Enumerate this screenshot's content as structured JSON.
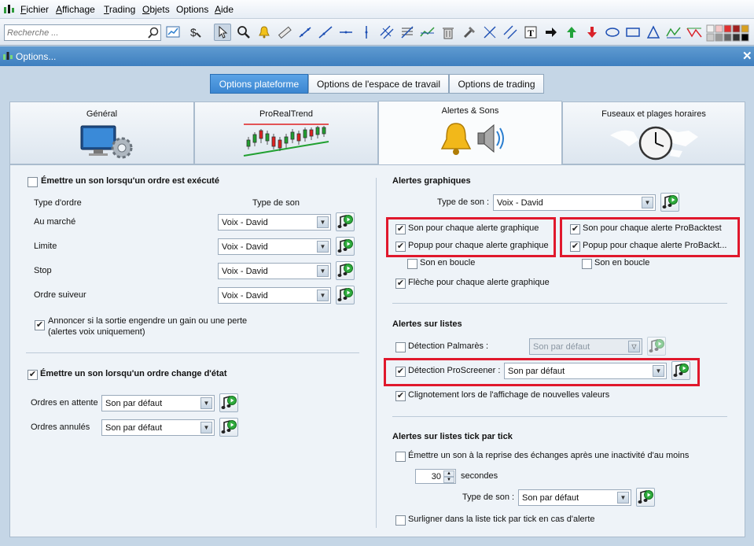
{
  "menubar": {
    "items": [
      {
        "label": "Fichier",
        "key": "F",
        "rest": "ichier"
      },
      {
        "label": "Affichage",
        "key": "A",
        "rest": "ffichage"
      },
      {
        "label": "Trading",
        "key": "T",
        "rest": "rading"
      },
      {
        "label": "Objets",
        "key": "O",
        "rest": "bjets"
      },
      {
        "label": "Options",
        "key": "",
        "rest": "Options"
      },
      {
        "label": "Aide",
        "key": "A",
        "rest": "ide"
      }
    ]
  },
  "toolbar": {
    "search_placeholder": "Recherche ...",
    "icons": [
      "chart-window-icon",
      "dollar-tool-icon",
      "pointer-icon",
      "zoom-icon",
      "alert-bell-icon",
      "ruler-icon",
      "line-icon",
      "line-icon",
      "horizontal-line-icon",
      "vertical-line-icon",
      "channel-icon",
      "fibonacci-icon",
      "trend-icon",
      "trash-icon",
      "tools-icon",
      "arrow-line-icon",
      "parallel-icon",
      "text-icon",
      "arrow-right-icon",
      "arrow-up-icon",
      "arrow-down-icon",
      "ellipse-icon",
      "rectangle-icon",
      "triangle-icon",
      "zigzag-icon",
      "pattern-icon",
      "color-palette-icon"
    ]
  },
  "window": {
    "title": "Options...",
    "close": "✕"
  },
  "segments": [
    {
      "label": "Options plateforme",
      "selected": true
    },
    {
      "label": "Options de l'espace de travail",
      "selected": false
    },
    {
      "label": "Options de trading",
      "selected": false
    }
  ],
  "tabs": [
    {
      "label": "Général",
      "icon": "monitor-gear-icon",
      "selected": false
    },
    {
      "label": "ProRealTrend",
      "icon": "candlestick-chart-icon",
      "selected": false
    },
    {
      "label": "Alertes & Sons",
      "icon": "bell-speaker-icon",
      "selected": true
    },
    {
      "label": "Fuseaux et plages horaires",
      "icon": "world-clock-icon",
      "selected": false
    }
  ],
  "left": {
    "order_exec": {
      "label": "Émettre un son lorsqu'un ordre est exécuté",
      "checked": false
    },
    "col_order_type": "Type d'ordre",
    "col_sound_type": "Type de son",
    "rows": [
      {
        "label": "Au marché",
        "value": "Voix - David"
      },
      {
        "label": "Limite",
        "value": "Voix - David"
      },
      {
        "label": "Stop",
        "value": "Voix - David"
      },
      {
        "label": "Ordre suiveur",
        "value": "Voix - David"
      }
    ],
    "announce": {
      "line1": "Annoncer si la sortie engendre un gain ou une perte",
      "line2": "(alertes voix uniquement)",
      "checked": true
    },
    "order_state": {
      "label": "Émettre un son lorsqu'un ordre change d'état",
      "checked": true
    },
    "state_rows": [
      {
        "label": "Ordres en attente",
        "value": "Son par défaut"
      },
      {
        "label": "Ordres annulés",
        "value": "Son par défaut"
      }
    ]
  },
  "right": {
    "graph_title": "Alertes graphiques",
    "sound_type_label": "Type de son :",
    "sound_type_value": "Voix - David",
    "graph_each": {
      "label": "Son pour chaque alerte graphique",
      "checked": true
    },
    "graph_popup": {
      "label": "Popup pour chaque alerte graphique",
      "checked": true
    },
    "graph_loop": {
      "label": "Son en boucle",
      "checked": false
    },
    "bt_each": {
      "label": "Son pour chaque alerte ProBacktest",
      "checked": true
    },
    "bt_popup": {
      "label": "Popup pour chaque alerte ProBackt...",
      "checked": true
    },
    "bt_loop": {
      "label": "Son en boucle",
      "checked": false
    },
    "arrow_each": {
      "label": "Flèche pour chaque alerte graphique",
      "checked": true
    },
    "lists_title": "Alertes sur listes",
    "palmares": {
      "label": "Détection Palmarès :",
      "checked": false,
      "value": "Son par défaut"
    },
    "screener": {
      "label": "Détection ProScreener :",
      "checked": true,
      "value": "Son par défaut"
    },
    "blink": {
      "label": "Clignotement lors de l'affichage de nouvelles valeurs",
      "checked": true
    },
    "tick_title": "Alertes sur listes tick par tick",
    "tick_emit": {
      "label": "Émettre un son à la reprise des échanges après une inactivité d'au moins",
      "checked": false
    },
    "seconds_value": "30",
    "seconds_label": "secondes",
    "tick_sound_label": "Type de son :",
    "tick_sound_value": "Son par défaut",
    "tick_highlight": {
      "label": "Surligner dans la liste tick par tick en cas d'alerte",
      "checked": false
    }
  }
}
